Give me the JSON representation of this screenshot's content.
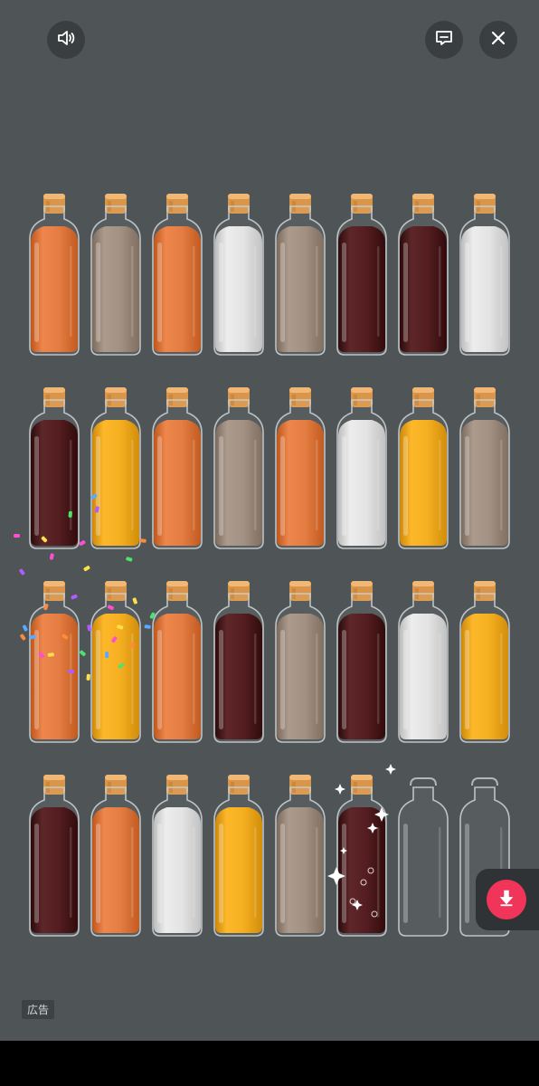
{
  "top_bar": {
    "sound_icon": "speaker-icon",
    "feedback_icon": "message-icon",
    "close_icon": "close-icon"
  },
  "liquid_colors": {
    "orange": "#e3773a",
    "taupe": "#9e8c7d",
    "white": "#e2e2e2",
    "maroon": "#4c1316",
    "yellow": "#f3ab16"
  },
  "rows": [
    [
      "orange",
      "taupe",
      "orange",
      "white",
      "taupe",
      "maroon",
      "maroon",
      "white"
    ],
    [
      "maroon",
      "yellow",
      "orange",
      "taupe",
      "orange",
      "white",
      "yellow",
      "taupe"
    ],
    [
      "orange",
      "yellow",
      "orange",
      "maroon",
      "taupe",
      "maroon",
      "white",
      "yellow"
    ],
    [
      "maroon",
      "orange",
      "white",
      "yellow",
      "taupe",
      "maroon",
      "empty",
      "empty"
    ]
  ],
  "ad": {
    "label": "広告"
  },
  "download_icon": "download-arrow-icon",
  "accent_color": "#f0345a"
}
